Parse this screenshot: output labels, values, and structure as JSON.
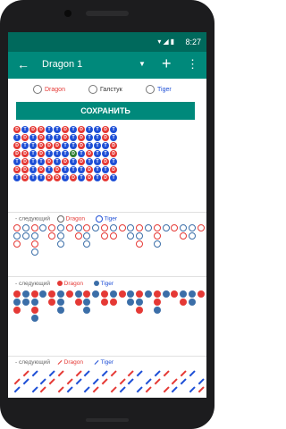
{
  "status": {
    "time": "8:27"
  },
  "appbar": {
    "title": "Dragon 1",
    "back_icon": "arrow-back-icon",
    "dropdown_icon": "caret-down-icon",
    "add_icon": "plus-icon",
    "more_icon": "more-vert-icon"
  },
  "radio": {
    "dragon": "Dragon",
    "tie": "Галстук",
    "tiger": "Tiger"
  },
  "save_label": "СОХРАНИТЬ",
  "sections": {
    "s1": {
      "label": "- следующий",
      "dragon": "Dragon",
      "tiger": "Tiger"
    },
    "s2": {
      "label": "- следующий",
      "dragon": "Dragon",
      "tiger": "Tiger"
    },
    "s3": {
      "label": "- следующий",
      "dragon": "Dragon",
      "tiger": "Tiger"
    }
  },
  "colors": {
    "primary": "#00897b",
    "dark": "#00695c",
    "dragon": "#e53935",
    "tiger": "#1e4fd6",
    "tie": "#2e7d32",
    "tiger_fill": "#3b6ea8"
  }
}
